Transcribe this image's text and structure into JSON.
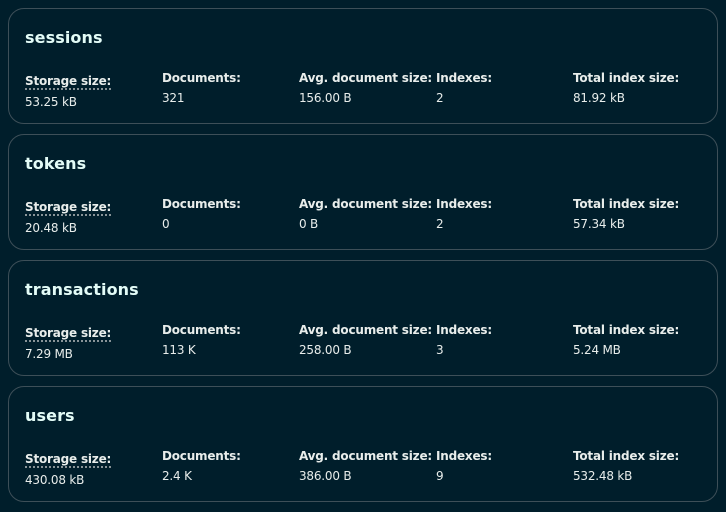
{
  "collections": [
    {
      "name": "sessions",
      "storage_size_label": "Storage size:",
      "storage_size": "53.25 kB",
      "documents_label": "Documents:",
      "documents": "321",
      "avg_doc_size_label": "Avg. document size:",
      "avg_doc_size": "156.00 B",
      "indexes_label": "Indexes:",
      "indexes": "2",
      "total_index_size_label": "Total index size:",
      "total_index_size": "81.92 kB"
    },
    {
      "name": "tokens",
      "storage_size_label": "Storage size:",
      "storage_size": "20.48 kB",
      "documents_label": "Documents:",
      "documents": "0",
      "avg_doc_size_label": "Avg. document size:",
      "avg_doc_size": "0 B",
      "indexes_label": "Indexes:",
      "indexes": "2",
      "total_index_size_label": "Total index size:",
      "total_index_size": "57.34 kB"
    },
    {
      "name": "transactions",
      "storage_size_label": "Storage size:",
      "storage_size": "7.29 MB",
      "documents_label": "Documents:",
      "documents": "113 K",
      "avg_doc_size_label": "Avg. document size:",
      "avg_doc_size": "258.00 B",
      "indexes_label": "Indexes:",
      "indexes": "3",
      "total_index_size_label": "Total index size:",
      "total_index_size": "5.24 MB"
    },
    {
      "name": "users",
      "storage_size_label": "Storage size:",
      "storage_size": "430.08 kB",
      "documents_label": "Documents:",
      "documents": "2.4 K",
      "avg_doc_size_label": "Avg. document size:",
      "avg_doc_size": "386.00 B",
      "indexes_label": "Indexes:",
      "indexes": "9",
      "total_index_size_label": "Total index size:",
      "total_index_size": "532.48 kB"
    }
  ]
}
